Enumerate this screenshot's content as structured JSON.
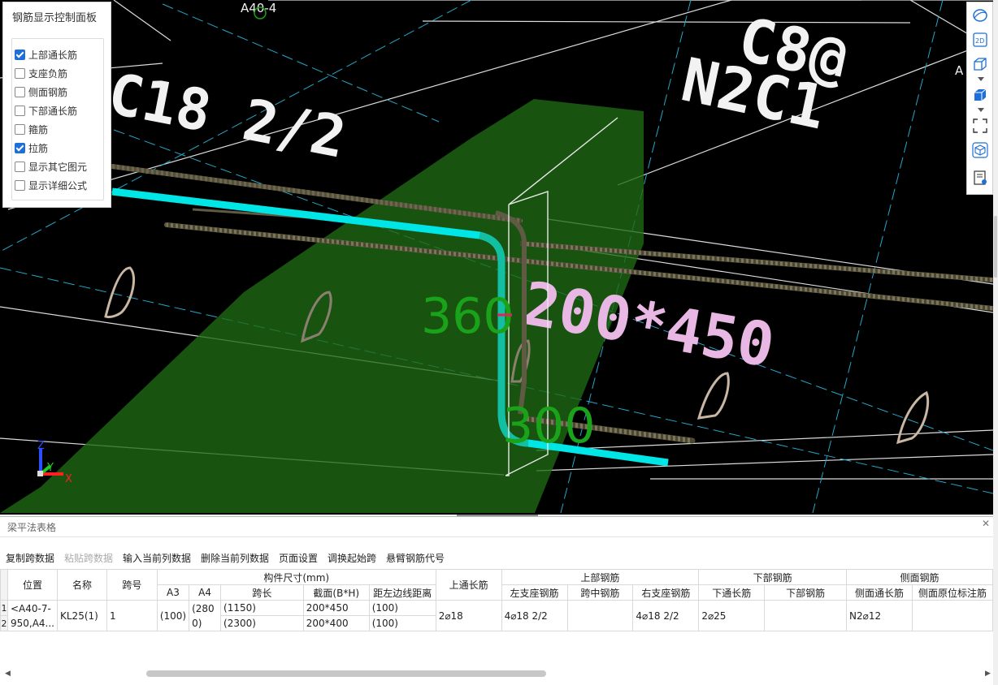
{
  "viewport": {
    "axis_label": "A40-4",
    "axis_label_right": "A",
    "big_texts": [
      "C8@",
      "N2C1",
      "C18 2/2",
      "200*450"
    ],
    "dim_360": "360",
    "dim_300": "300",
    "axes": {
      "z": "Z",
      "y": "Y",
      "x": "X"
    },
    "colors": {
      "background": "#000000",
      "rebar_highlight": "#00e6e6",
      "green_face": "#1f6a14",
      "dim_text": "#1aa31a"
    }
  },
  "control_panel": {
    "title": "钢筋显示控制面板",
    "options": [
      {
        "label": "上部通长筋",
        "checked": true
      },
      {
        "label": "支座负筋",
        "checked": false
      },
      {
        "label": "侧面钢筋",
        "checked": false
      },
      {
        "label": "下部通长筋",
        "checked": false
      },
      {
        "label": "箍筋",
        "checked": false
      },
      {
        "label": "拉筋",
        "checked": true
      },
      {
        "label": "显示其它图元",
        "checked": false
      },
      {
        "label": "显示详细公式",
        "checked": false
      }
    ]
  },
  "right_toolbar": {
    "icons": [
      "orbit-icon",
      "2d-view-icon",
      "3d-box-icon",
      "solid-box-icon",
      "fit-view-icon",
      "cube-view-icon",
      "layers-icon"
    ],
    "view_2d_label": "2D"
  },
  "bottom_panel": {
    "title": "梁平法表格",
    "toolbar": [
      {
        "label": "复制跨数据",
        "enabled": true
      },
      {
        "label": "粘贴跨数据",
        "enabled": false
      },
      {
        "label": "输入当前列数据",
        "enabled": true
      },
      {
        "label": "删除当前列数据",
        "enabled": true
      },
      {
        "label": "页面设置",
        "enabled": true
      },
      {
        "label": "调换起始跨",
        "enabled": true
      },
      {
        "label": "悬臂钢筋代号",
        "enabled": true
      }
    ],
    "headers": {
      "position": "位置",
      "name": "名称",
      "span_no": "跨号",
      "size_group": "构件尺寸(mm)",
      "a3": "A3",
      "a4": "A4",
      "span_len": "跨长",
      "section": "截面(B*H)",
      "dist_edge": "距左边线距离",
      "top_through": "上通长筋",
      "top_group": "上部钢筋",
      "left_support": "左支座钢筋",
      "mid_span": "跨中钢筋",
      "right_support": "右支座钢筋",
      "bottom_group": "下部钢筋",
      "bottom_through": "下通长筋",
      "bottom_rebar": "下部钢筋",
      "side_group": "侧面钢筋",
      "side_through": "侧面通长筋",
      "side_in_situ": "侧面原位标注筋"
    },
    "row": {
      "row_numbers": [
        "1",
        "2"
      ],
      "position": "<A40-7-950,A4...",
      "name": "KL25(1)",
      "span_no": "1",
      "a3": "(100)",
      "a4": "(2800)",
      "span_len": [
        "(1150)",
        "(2300)"
      ],
      "section": [
        "200*450",
        "200*400"
      ],
      "dist_edge": [
        "(100)",
        "(100)"
      ],
      "top_through": "2⌀18",
      "left_support": "4⌀18 2/2",
      "mid_span": "",
      "right_support": "4⌀18 2/2",
      "bottom_through": "2⌀25",
      "bottom_rebar": "",
      "side_through": "N2⌀12",
      "side_in_situ": ""
    }
  }
}
